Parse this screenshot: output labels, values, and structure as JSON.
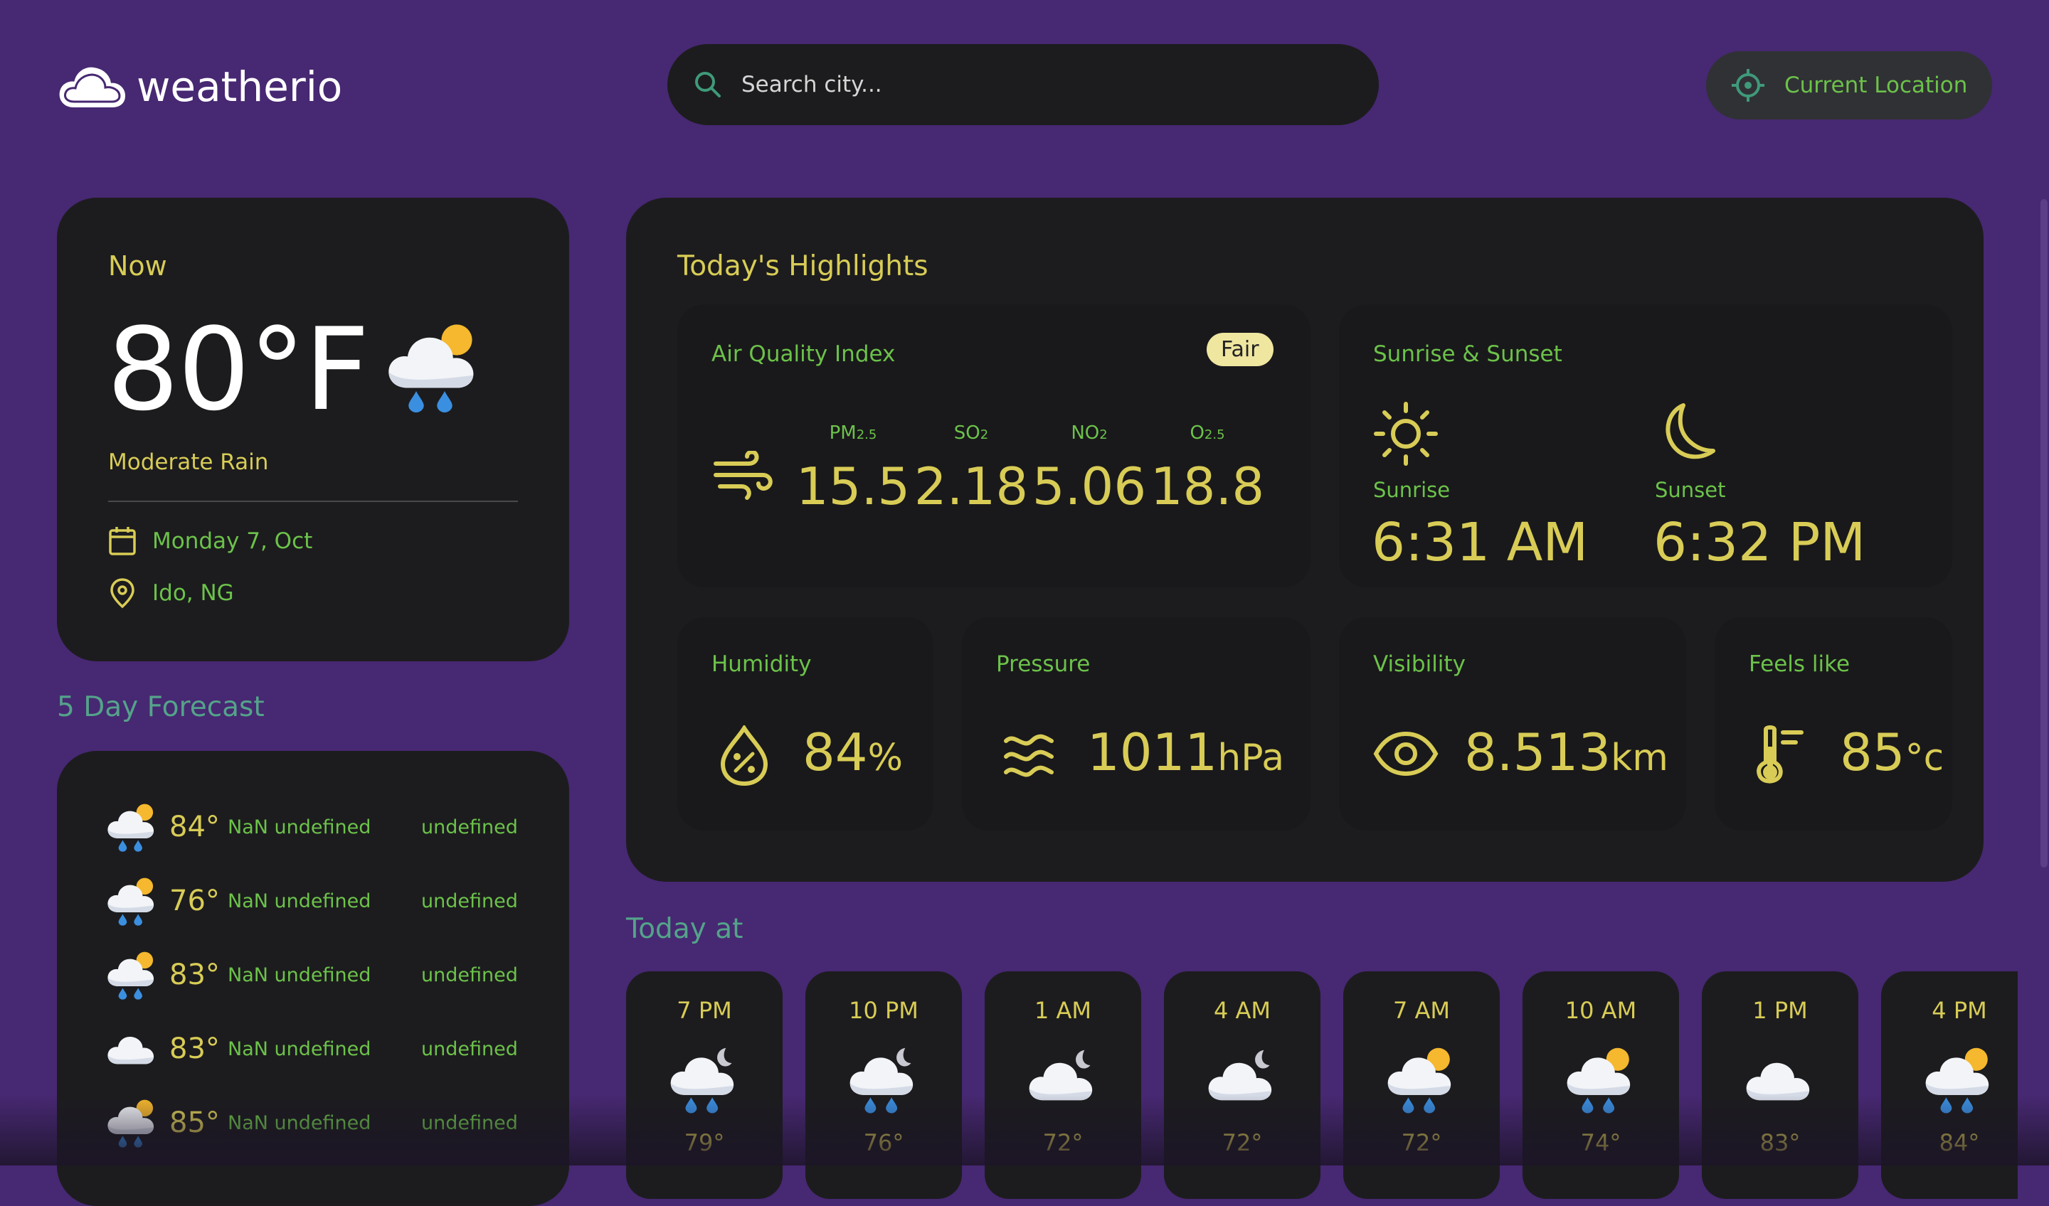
{
  "app": {
    "name": "weatherio"
  },
  "search": {
    "placeholder": "Search city..."
  },
  "location_button": {
    "label": "Current Location"
  },
  "now": {
    "title": "Now",
    "temperature": "80°F",
    "description": "Moderate Rain",
    "date": "Monday 7, Oct",
    "location": "Ido, NG",
    "icon": "rain-sun-icon"
  },
  "forecast": {
    "title": "5 Day Forecast",
    "items": [
      {
        "icon": "rain-sun-icon",
        "temp": "84°",
        "date": "NaN undefined",
        "day": "undefined"
      },
      {
        "icon": "rain-sun-icon",
        "temp": "76°",
        "date": "NaN undefined",
        "day": "undefined"
      },
      {
        "icon": "rain-sun-icon",
        "temp": "83°",
        "date": "NaN undefined",
        "day": "undefined"
      },
      {
        "icon": "cloud-icon",
        "temp": "83°",
        "date": "NaN undefined",
        "day": "undefined"
      },
      {
        "icon": "storm-sun-icon",
        "temp": "85°",
        "date": "NaN undefined",
        "day": "undefined"
      }
    ]
  },
  "highlights": {
    "title": "Today's Highlights",
    "air_quality": {
      "title": "Air Quality Index",
      "badge": "Fair",
      "items": [
        {
          "label": "PM",
          "sub": "2.5",
          "value": "15.5"
        },
        {
          "label": "SO",
          "sub": "2",
          "value": "2.18"
        },
        {
          "label": "NO",
          "sub": "2",
          "value": "5.06"
        },
        {
          "label": "O",
          "sub": "2.5",
          "value": "18.8"
        }
      ]
    },
    "sun": {
      "title": "Sunrise & Sunset",
      "sunrise_label": "Sunrise",
      "sunrise": "6:31 AM",
      "sunset_label": "Sunset",
      "sunset": "6:32 PM"
    },
    "humidity": {
      "title": "Humidity",
      "value": "84",
      "unit": "%"
    },
    "pressure": {
      "title": "Pressure",
      "value": "1011",
      "unit": "hPa"
    },
    "visibility": {
      "title": "Visibility",
      "value": "8.513",
      "unit": "km"
    },
    "feels_like": {
      "title": "Feels like",
      "value": "85",
      "unit": "°c"
    }
  },
  "today": {
    "title": "Today at",
    "hours": [
      {
        "time": "7 PM",
        "icon": "rain-moon-icon",
        "temp": "79°"
      },
      {
        "time": "10 PM",
        "icon": "rain-moon-icon",
        "temp": "76°"
      },
      {
        "time": "1 AM",
        "icon": "cloud-moon-icon",
        "temp": "72°"
      },
      {
        "time": "4 AM",
        "icon": "cloud-moon-icon",
        "temp": "72°"
      },
      {
        "time": "7 AM",
        "icon": "rain-sun-icon",
        "temp": "72°"
      },
      {
        "time": "10 AM",
        "icon": "rain-sun-icon",
        "temp": "74°"
      },
      {
        "time": "1 PM",
        "icon": "cloud-icon",
        "temp": "83°"
      },
      {
        "time": "4 PM",
        "icon": "rain-sun-icon",
        "temp": "84°"
      }
    ]
  },
  "colors": {
    "background": "#472872",
    "card": "#1c1c1e",
    "accent_yellow": "#d8cc56",
    "accent_green": "#6cc24a",
    "section_title": "#54a38a"
  }
}
